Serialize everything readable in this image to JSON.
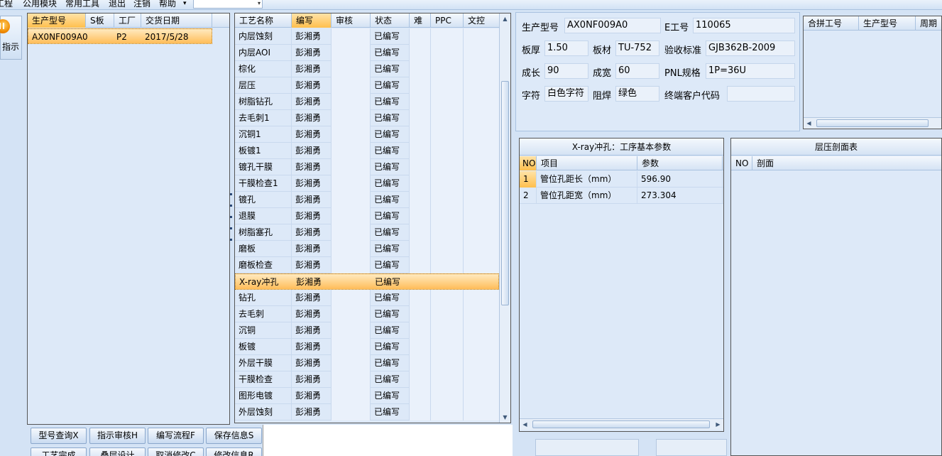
{
  "menu": {
    "items": [
      "工程",
      "公用模块",
      "常用工具",
      "退出",
      "注销",
      "帮助"
    ],
    "help_arrow": "▾",
    "combo_arrow": "▾"
  },
  "indicator": {
    "label": "指示"
  },
  "orders": {
    "columns": [
      "生产型号",
      "S板",
      "工厂",
      "交货日期"
    ],
    "rows": [
      {
        "model": "AX0NF009A0",
        "s_board": "",
        "factory": "P2",
        "date": "2017/5/28"
      }
    ]
  },
  "process": {
    "columns": [
      "工艺名称",
      "编写",
      "审核",
      "状态",
      "难",
      "PPC",
      "文控"
    ],
    "selected_index": 15,
    "rows": [
      {
        "name": "内层蚀刻",
        "writer": "彭湘勇",
        "status": "已编写"
      },
      {
        "name": "内层AOI",
        "writer": "彭湘勇",
        "status": "已编写"
      },
      {
        "name": "棕化",
        "writer": "彭湘勇",
        "status": "已编写"
      },
      {
        "name": "层压",
        "writer": "彭湘勇",
        "status": "已编写"
      },
      {
        "name": "树脂钻孔",
        "writer": "彭湘勇",
        "status": "已编写"
      },
      {
        "name": "去毛刺1",
        "writer": "彭湘勇",
        "status": "已编写"
      },
      {
        "name": "沉铜1",
        "writer": "彭湘勇",
        "status": "已编写"
      },
      {
        "name": "板镀1",
        "writer": "彭湘勇",
        "status": "已编写"
      },
      {
        "name": "镀孔干膜",
        "writer": "彭湘勇",
        "status": "已编写"
      },
      {
        "name": "干膜检查1",
        "writer": "彭湘勇",
        "status": "已编写"
      },
      {
        "name": "镀孔",
        "writer": "彭湘勇",
        "status": "已编写"
      },
      {
        "name": "退膜",
        "writer": "彭湘勇",
        "status": "已编写"
      },
      {
        "name": "树脂塞孔",
        "writer": "彭湘勇",
        "status": "已编写"
      },
      {
        "name": "磨板",
        "writer": "彭湘勇",
        "status": "已编写"
      },
      {
        "name": "磨板检查",
        "writer": "彭湘勇",
        "status": "已编写"
      },
      {
        "name": "X-ray冲孔",
        "writer": "彭湘勇",
        "status": "已编写"
      },
      {
        "name": "钻孔",
        "writer": "彭湘勇",
        "status": "已编写"
      },
      {
        "name": "去毛刺",
        "writer": "彭湘勇",
        "status": "已编写"
      },
      {
        "name": "沉铜",
        "writer": "彭湘勇",
        "status": "已编写"
      },
      {
        "name": "板镀",
        "writer": "彭湘勇",
        "status": "已编写"
      },
      {
        "name": "外层干膜",
        "writer": "彭湘勇",
        "status": "已编写"
      },
      {
        "name": "干膜检查",
        "writer": "彭湘勇",
        "status": "已编写"
      },
      {
        "name": "图形电镀",
        "writer": "彭湘勇",
        "status": "已编写"
      },
      {
        "name": "外层蚀刻",
        "writer": "彭湘勇",
        "status": "已编写"
      }
    ]
  },
  "buttons": {
    "row1": [
      "型号查询X",
      "指示审核H",
      "编写流程F",
      "保存信息S"
    ],
    "row2": [
      "工艺完成",
      "叠层设计",
      "取消修改C",
      "修改信息R"
    ]
  },
  "info": {
    "model_label": "生产型号",
    "model_value": "AX0NF009A0",
    "eno_label": "E工号",
    "eno_value": "110065",
    "thickness_label": "板厚",
    "thickness_value": "1.50",
    "material_label": "板材",
    "material_value": "TU-752",
    "standard_label": "验收标准",
    "standard_value": "GJB362B-2009",
    "length_label": "成长",
    "length_value": "90",
    "width_label": "成宽",
    "width_value": "60",
    "pnl_label": "PNL规格",
    "pnl_value": "1P=36U",
    "char_label": "字符",
    "char_value": "白色字符",
    "mask_label": "阻焊",
    "mask_value": "绿色",
    "customer_label": "终端客户代码",
    "customer_value": ""
  },
  "merge": {
    "columns": [
      "合拼工号",
      "生产型号",
      "周期"
    ]
  },
  "params": {
    "title": "X-ray冲孔：工序基本参数",
    "columns": [
      "NO",
      "项目",
      "参数"
    ],
    "rows": [
      {
        "no": "1",
        "item": "管位孔距长（mm）",
        "value": "596.90"
      },
      {
        "no": "2",
        "item": "管位孔距宽（mm）",
        "value": "273.304"
      }
    ]
  },
  "profile": {
    "title": "层压剖面表",
    "columns": [
      "NO",
      "剖面"
    ]
  }
}
